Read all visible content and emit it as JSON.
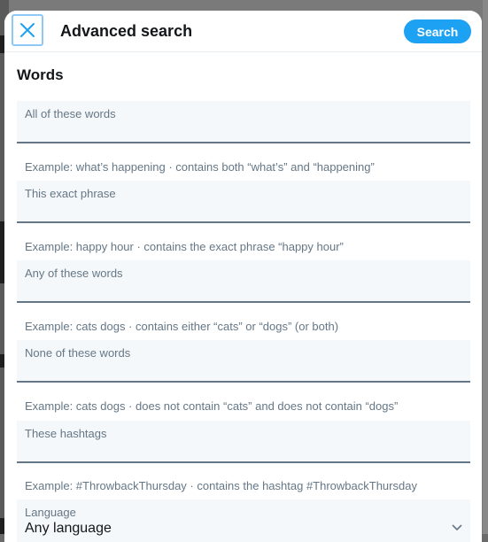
{
  "header": {
    "title": "Advanced search",
    "search_label": "Search"
  },
  "section": {
    "title": "Words"
  },
  "fields": [
    {
      "label": "All of these words",
      "value": "",
      "hint": "Example: what’s happening · contains both “what’s” and “happening”"
    },
    {
      "label": "This exact phrase",
      "value": "",
      "hint": "Example: happy hour · contains the exact phrase “happy hour”"
    },
    {
      "label": "Any of these words",
      "value": "",
      "hint": "Example: cats dogs · contains either “cats” or “dogs” (or both)"
    },
    {
      "label": "None of these words",
      "value": "",
      "hint": "Example: cats dogs · does not contain “cats” and does not contain “dogs”"
    },
    {
      "label": "These hashtags",
      "value": "",
      "hint": "Example: #ThrowbackThursday · contains the hashtag #ThrowbackThursday"
    }
  ],
  "language": {
    "label": "Language",
    "selected": "Any language"
  },
  "colors": {
    "accent": "#1da1f2",
    "field_bg": "#f5f8fa",
    "muted_text": "#657786"
  }
}
